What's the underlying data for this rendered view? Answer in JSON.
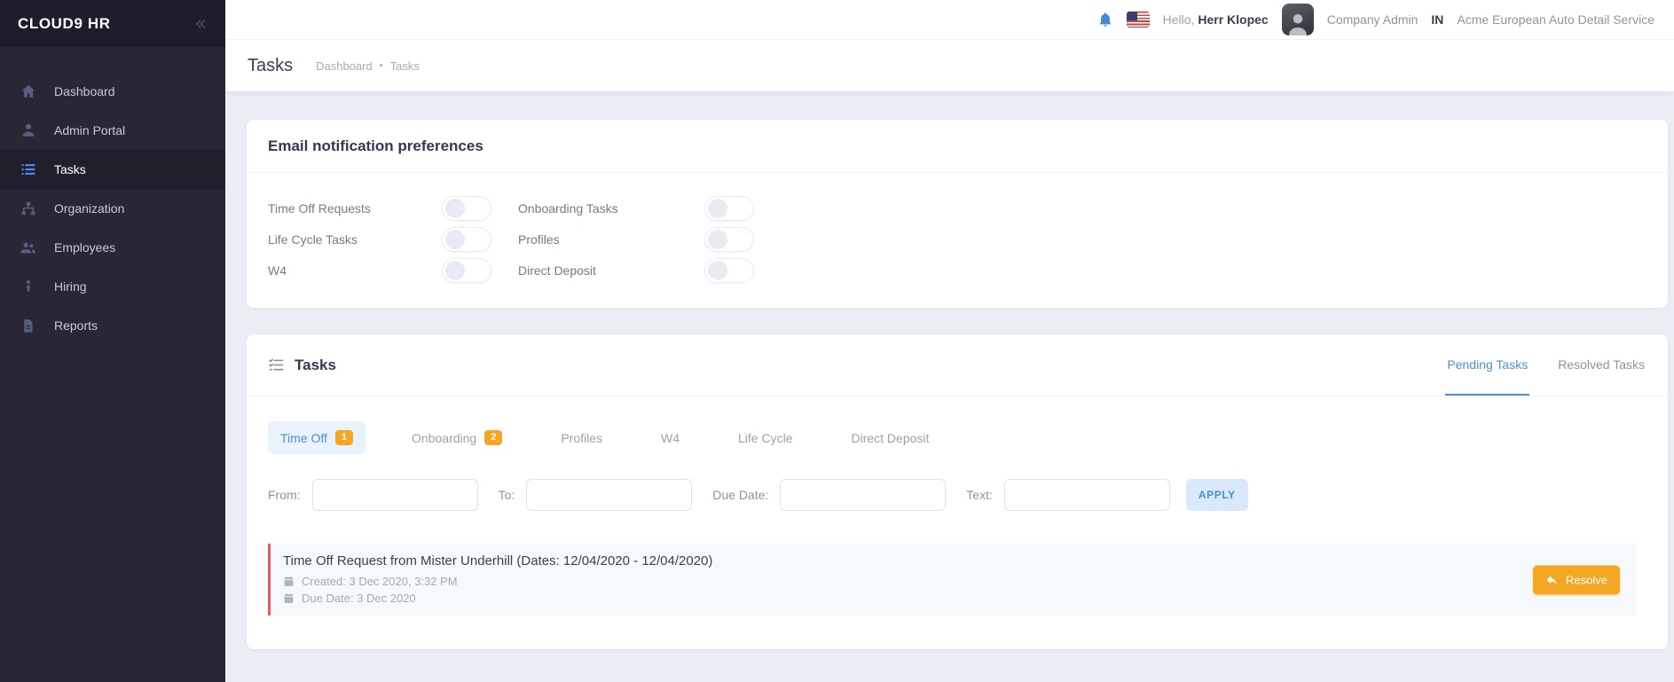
{
  "app": {
    "name": "CLOUD9 HR"
  },
  "sidebar": {
    "items": [
      {
        "label": "Dashboard",
        "icon": "home-icon"
      },
      {
        "label": "Admin Portal",
        "icon": "person-icon"
      },
      {
        "label": "Tasks",
        "icon": "list-icon",
        "active": true
      },
      {
        "label": "Organization",
        "icon": "sitemap-icon"
      },
      {
        "label": "Employees",
        "icon": "people-icon"
      },
      {
        "label": "Hiring",
        "icon": "hiring-icon"
      },
      {
        "label": "Reports",
        "icon": "report-icon"
      }
    ]
  },
  "header": {
    "greeting_prefix": "Hello,",
    "user_name": "Herr Klopec",
    "role": "Company Admin",
    "location": "IN",
    "company": "Acme European Auto Detail Service"
  },
  "page": {
    "title": "Tasks",
    "breadcrumb_root": "Dashboard",
    "breadcrumb_sep": "•",
    "breadcrumb_current": "Tasks"
  },
  "preferences": {
    "title": "Email notification preferences",
    "items": [
      {
        "label": "Time Off Requests",
        "state": "off"
      },
      {
        "label": "Onboarding Tasks",
        "state": "off"
      },
      {
        "label": "Life Cycle Tasks",
        "state": "off"
      },
      {
        "label": "Profiles",
        "state": "off"
      },
      {
        "label": "W4",
        "state": "off"
      },
      {
        "label": "Direct Deposit",
        "state": "off"
      }
    ]
  },
  "tasks": {
    "title": "Tasks",
    "tabs": {
      "pending": "Pending Tasks",
      "resolved": "Resolved Tasks",
      "active": "Pending Tasks"
    },
    "categories": [
      {
        "label": "Time Off",
        "badge": "1",
        "active": true
      },
      {
        "label": "Onboarding",
        "badge": "2"
      },
      {
        "label": "Profiles"
      },
      {
        "label": "W4"
      },
      {
        "label": "Life Cycle"
      },
      {
        "label": "Direct Deposit"
      }
    ],
    "filters": {
      "from": "From:",
      "to": "To:",
      "due": "Due Date:",
      "text": "Text:",
      "apply": "APPLY"
    },
    "items": [
      {
        "title": "Time Off Request from Mister Underhill (Dates: 12/04/2020 - 12/04/2020)",
        "created": "Created: 3 Dec 2020, 3:32 PM",
        "due": "Due Date: 3 Dec 2020",
        "action": "Resolve"
      }
    ]
  },
  "colors": {
    "accent_blue": "#4a90d2",
    "badge_orange": "#f5a623",
    "task_border_red": "#e15f5f",
    "sidebar_bg": "#292735",
    "bell_blue": "#3f8cd6"
  }
}
